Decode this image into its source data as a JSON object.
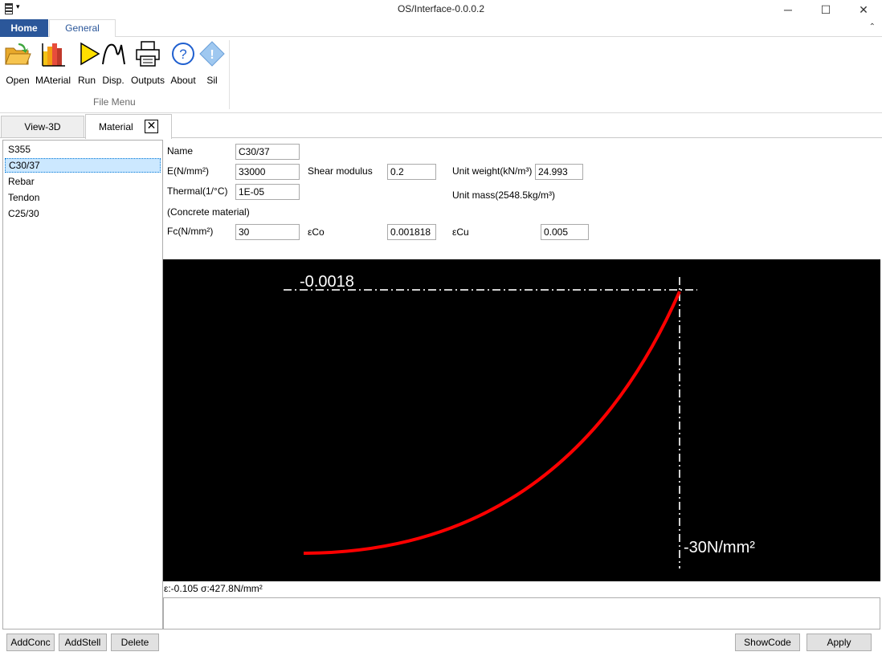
{
  "window": {
    "title": "OS/Interface-0.0.0.2",
    "minimize": "─",
    "maximize": "☐",
    "close": "✕"
  },
  "ribbon": {
    "tabs": {
      "home": "Home",
      "general": "General"
    },
    "collapse_glyph": "⌃",
    "buttons": {
      "open": "Open",
      "material": "MAterial",
      "run": "Run",
      "disp": "Disp.",
      "outputs": "Outputs",
      "about": "About",
      "sil": "Sil"
    },
    "group_label": "File Menu"
  },
  "doc_tabs": {
    "view3d": "View-3D",
    "material": "Material",
    "close_glyph": "✕"
  },
  "materials": [
    "S355",
    "C30/37",
    "Rebar",
    "Tendon",
    "C25/30"
  ],
  "selected_material": "C30/37",
  "properties": {
    "name_label": "Name",
    "name_value": "C30/37",
    "e_label": "E(N/mm²)",
    "e_value": "33000",
    "shear_label": "Shear modulus",
    "shear_value": "0.2",
    "unit_weight_label": "Unit weight(kN/m³)",
    "unit_weight_value": "24.993",
    "thermal_label": "Thermal(1/°C)",
    "thermal_value": "1E-05",
    "unit_mass_label": "Unit mass(2548.5kg/m³)",
    "concrete_label": "(Concrete material)",
    "fc_label": "Fc(N/mm²)",
    "fc_value": "30",
    "eco_label": "εCo",
    "eco_value": "0.001818",
    "ecu_label": "εCu",
    "ecu_value": "0.005"
  },
  "graph": {
    "strain_label": "-0.0018",
    "stress_label": "-30N/mm²",
    "curve_color": "#ff0000",
    "axis_color": "#d0d0d0",
    "background": "#000000"
  },
  "status": {
    "text": "ε:-0.105  σ:427.8N/mm²"
  },
  "buttons": {
    "add_conc": "AddConc",
    "add_stell": "AddStell",
    "delete": "Delete",
    "show_code": "ShowCode",
    "apply": "Apply"
  },
  "colors": {
    "accent": "#2b579a",
    "selection": "#cce8ff"
  }
}
